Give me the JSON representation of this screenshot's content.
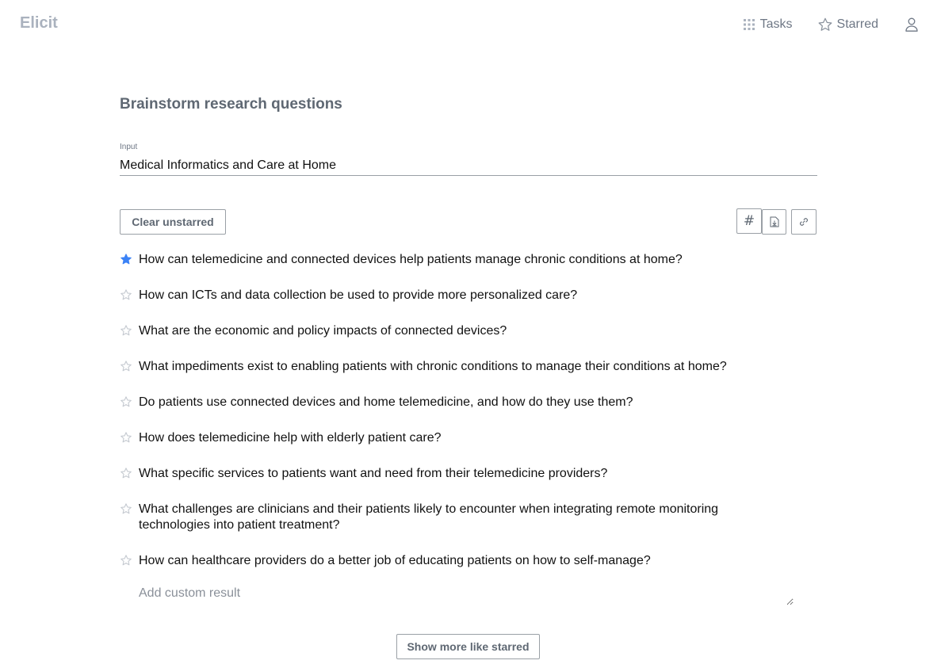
{
  "header": {
    "logo": "Elicit",
    "nav": {
      "tasks_label": "Tasks",
      "starred_label": "Starred"
    }
  },
  "main": {
    "title": "Brainstorm research questions",
    "input": {
      "label": "Input",
      "value": "Medical Informatics and Care at Home"
    },
    "toolbar": {
      "clear_label": "Clear unstarred",
      "hash_label": "#"
    },
    "results": [
      {
        "text": "How can telemedicine and connected devices help patients manage chronic conditions at home?",
        "starred": true
      },
      {
        "text": "How can ICTs and data collection be used to provide more personalized care?",
        "starred": false
      },
      {
        "text": "What are the economic and policy impacts of connected devices?",
        "starred": false
      },
      {
        "text": "What impediments exist to enabling patients with chronic conditions to manage their conditions at home?",
        "starred": false
      },
      {
        "text": "Do patients use connected devices and home telemedicine, and how do they use them?",
        "starred": false
      },
      {
        "text": "How does telemedicine help with elderly patient care?",
        "starred": false
      },
      {
        "text": "What specific services to patients want and need from their telemedicine providers?",
        "starred": false
      },
      {
        "text": "What challenges are clinicians and their patients likely to encounter when integrating remote monitoring technologies into patient treatment?",
        "starred": false
      },
      {
        "text": "How can healthcare providers do a better job of educating patients on how to self-manage?",
        "starred": false
      }
    ],
    "custom_result_placeholder": "Add custom result",
    "show_more_label": "Show more like starred"
  },
  "colors": {
    "star_active": "#3b82f6",
    "star_inactive": "#c3c8cf",
    "muted_text": "#5f6873",
    "logo": "#aab2be"
  },
  "icons": {
    "tasks": "grid-icon",
    "starred": "star-outline-icon",
    "user": "user-icon",
    "export": "file-download-icon",
    "link": "link-icon"
  }
}
